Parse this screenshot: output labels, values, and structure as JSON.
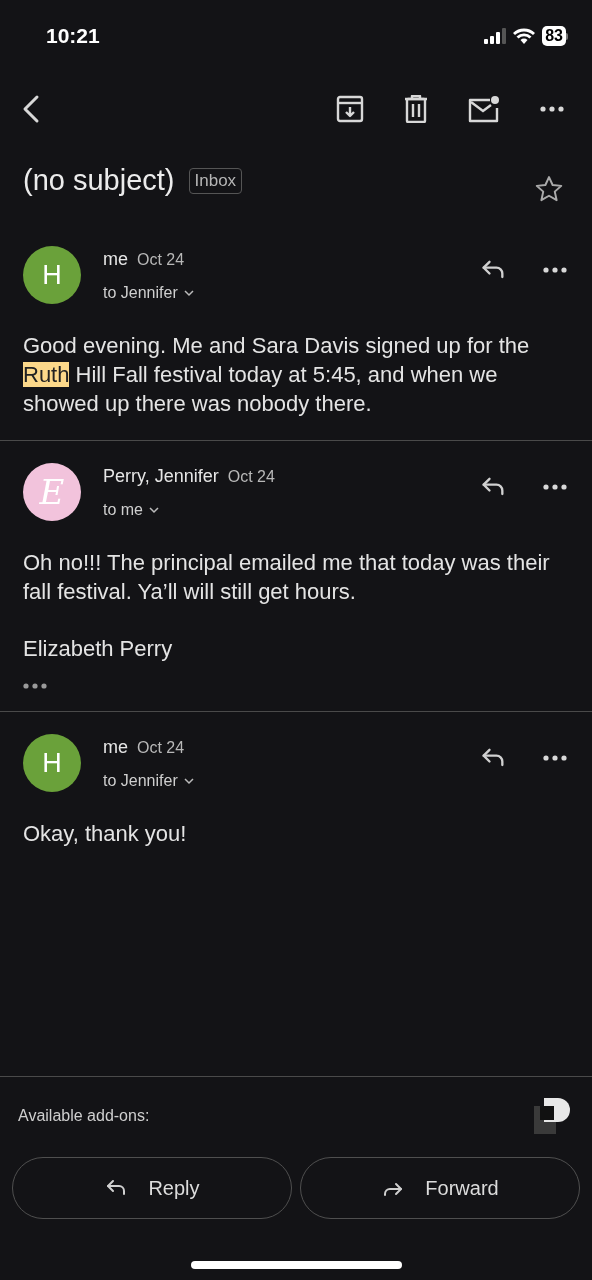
{
  "status_bar": {
    "time": "10:21",
    "battery": "83"
  },
  "subject": "(no subject)",
  "label": "Inbox",
  "starred": false,
  "messages": [
    {
      "sender": "me",
      "date": "Oct 24",
      "recipient": "to Jennifer",
      "avatar": {
        "kind": "letter",
        "letter": "H",
        "color": "#6aa13a"
      },
      "body": [
        [
          {
            "text": "Good evening. Me and Sara Davis signed up for the ",
            "highlighted": false
          },
          {
            "text": "Ruth",
            "highlighted": true
          },
          {
            "text": " Hill Fall festival today at 5:45, and when we showed up there was nobody there.",
            "highlighted": false
          }
        ]
      ],
      "trimmed": false
    },
    {
      "sender": "Perry, Jennifer",
      "date": "Oct 24",
      "recipient": "to me",
      "avatar": {
        "kind": "monogram",
        "letter": "E",
        "color": "#f2c3dc"
      },
      "body": [
        [
          {
            "text": "Oh no!!! The principal emailed me that today was their fall festival. Ya’ll will still get hours.",
            "highlighted": false
          }
        ],
        [
          {
            "text": "Elizabeth Perry",
            "highlighted": false
          }
        ]
      ],
      "trimmed": true
    },
    {
      "sender": "me",
      "date": "Oct 24",
      "recipient": "to Jennifer",
      "avatar": {
        "kind": "letter",
        "letter": "H",
        "color": "#6aa13a"
      },
      "body": [
        [
          {
            "text": "Okay, thank you!",
            "highlighted": false
          }
        ]
      ],
      "trimmed": false
    }
  ],
  "addons_label": "Available add-ons:",
  "actions": [
    {
      "kind": "reply",
      "label": "Reply"
    },
    {
      "kind": "forward",
      "label": "Forward"
    }
  ]
}
